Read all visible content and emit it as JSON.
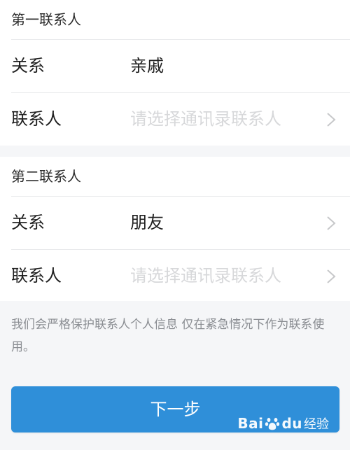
{
  "section1": {
    "title": "第一联系人",
    "relation_label": "关系",
    "relation_value": "亲戚",
    "contact_label": "联系人",
    "contact_placeholder": "请选择通讯录联系人"
  },
  "section2": {
    "title": "第二联系人",
    "relation_label": "关系",
    "relation_value": "朋友",
    "contact_label": "联系人",
    "contact_placeholder": "请选择通讯录联系人"
  },
  "note": "我们会严格保护联系人个人信息 仅在紧急情况下作为联系使用。",
  "next_button": "下一步",
  "watermark": {
    "logo": "Bai",
    "logo_suffix": "du",
    "text": "经验"
  },
  "colors": {
    "accent": "#2f8fd9",
    "placeholder": "#d7d8da",
    "note": "#8a8d92"
  },
  "icons": {
    "row_action": "chevron-right-icon",
    "watermark": "paw-icon"
  }
}
